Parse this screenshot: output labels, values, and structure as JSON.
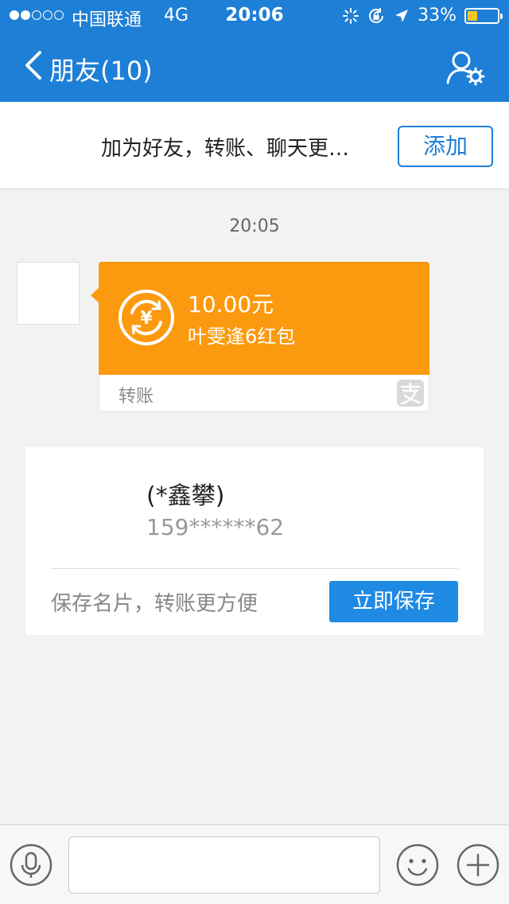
{
  "status_bar": {
    "signal_dots": [
      true,
      true,
      false,
      false,
      false
    ],
    "carrier": "中国联通",
    "network": "4G",
    "time": "20:06",
    "battery_text": "33%",
    "battery_level": 0.33,
    "icons": [
      "loading-spinner-icon",
      "orientation-lock-icon",
      "location-arrow-icon"
    ]
  },
  "nav": {
    "back_icon": "chevron-left-icon",
    "title": "朋友(10)",
    "right_icon": "user-settings-icon"
  },
  "add_friend": {
    "text": "加为好友，转账、聊天更…",
    "button": "添加"
  },
  "chat": {
    "timestamp": "20:05",
    "transfer": {
      "amount": "10.00元",
      "description": "叶雯逢6红包",
      "label": "转账",
      "coin_symbol": "¥",
      "logo_icon": "alipay-icon",
      "color": "#fb9a0e"
    },
    "contact_card": {
      "name": "(*鑫攀)",
      "phone": "159******62",
      "hint": "保存名片，转账更方便",
      "save_button": "立即保存"
    }
  },
  "input_bar": {
    "placeholder": "",
    "icons": [
      "microphone-icon",
      "emoji-icon",
      "plus-icon"
    ]
  },
  "colors": {
    "primary": "#1e7fd6",
    "accent": "#fb9a0e"
  }
}
